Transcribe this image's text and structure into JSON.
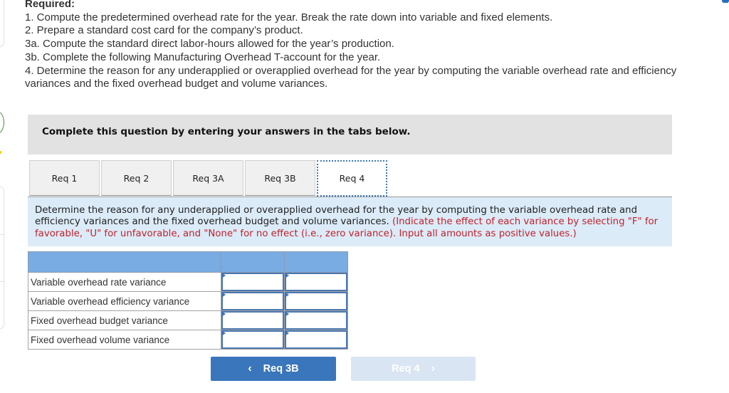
{
  "required": {
    "title": "Required:",
    "items": [
      "1. Compute the predetermined overhead rate for the year. Break the rate down into variable and fixed elements.",
      "2. Prepare a standard cost card for the company’s product.",
      "3a. Compute the standard direct labor-hours allowed for the year’s production.",
      "3b. Complete the following Manufacturing Overhead T-account for the year.",
      "4. Determine the reason for any underapplied or overapplied overhead for the year by computing the variable overhead rate and efficiency variances and the fixed overhead budget and volume variances."
    ]
  },
  "instruction_bar": "Complete this question by entering your answers in the tabs below.",
  "tabs": [
    {
      "label": "Req 1",
      "active": false
    },
    {
      "label": "Req 2",
      "active": false
    },
    {
      "label": "Req 3A",
      "active": false
    },
    {
      "label": "Req 3B",
      "active": false
    },
    {
      "label": "Req 4",
      "active": true
    }
  ],
  "question": {
    "text": "Determine the reason for any underapplied or overapplied overhead for the year by computing the variable overhead rate and efficiency variances and the fixed overhead budget and volume variances.",
    "note": "(Indicate the effect of each variance by selecting \"F\" for favorable, \"U\" for unfavorable, and \"None\" for no effect (i.e., zero variance). Input all amounts as positive values.)"
  },
  "variance_table": {
    "rows": [
      {
        "label": "Variable overhead rate variance",
        "amount": "",
        "effect": ""
      },
      {
        "label": "Variable overhead efficiency variance",
        "amount": "",
        "effect": ""
      },
      {
        "label": "Fixed overhead budget variance",
        "amount": "",
        "effect": ""
      },
      {
        "label": "Fixed overhead volume variance",
        "amount": "",
        "effect": ""
      }
    ]
  },
  "navigation": {
    "prev_label": "Req 3B",
    "prev_icon": "chevron-left-icon",
    "next_label": "Req 4",
    "next_icon": "chevron-right-icon",
    "next_disabled": true
  },
  "colors": {
    "accent": "#3a76bb",
    "table_header": "#79ace2",
    "question_bg": "#dcebf8",
    "note_red": "#c0232b",
    "instruction_bg": "#e2e2e2"
  }
}
